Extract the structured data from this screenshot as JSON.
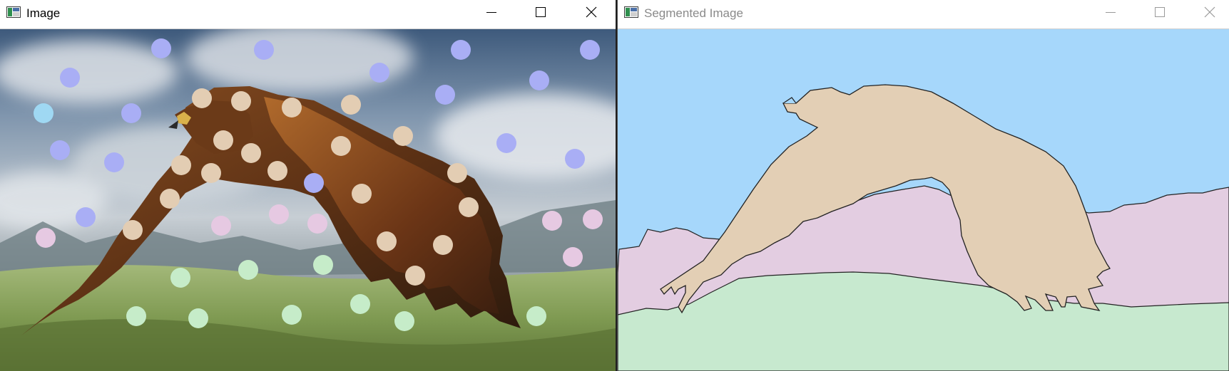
{
  "left_window": {
    "title": "Image",
    "icon": "opencv-window-icon",
    "controls": [
      "minimize-icon",
      "maximize-icon",
      "close-icon"
    ],
    "active": true,
    "content": "eagle photograph with colored seed markers"
  },
  "right_window": {
    "title": "Segmented Image",
    "icon": "opencv-window-icon",
    "controls": [
      "minimize-icon",
      "maximize-icon",
      "close-icon"
    ],
    "active": false
  },
  "colors": {
    "sky": "#a6d7fb",
    "mountain": "#e3cde1",
    "grass": "#c7e9cf",
    "eagle": "#e3cfb5",
    "seed_sky_blue": "#a9aef5",
    "seed_sky_cyan": "#9fd8f3",
    "seed_eagle": "#e3cdb3",
    "seed_mountain": "#e6c9e2",
    "seed_grass": "#c6ecc9"
  }
}
